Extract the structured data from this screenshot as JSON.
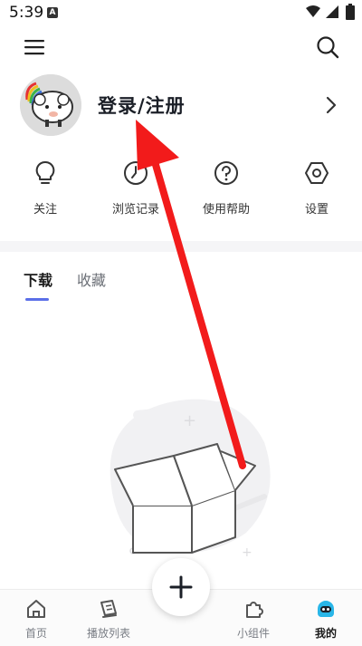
{
  "status_bar": {
    "time": "5:39",
    "app_badge": "A"
  },
  "profile": {
    "login_label": "登录/注册"
  },
  "quick_actions": [
    "关注",
    "浏览记录",
    "使用帮助",
    "设置"
  ],
  "tabs": {
    "downloads": "下载",
    "favorites": "收藏"
  },
  "bottom_nav": {
    "home": "首页",
    "playlist": "播放列表",
    "widgets": "小组件",
    "mine": "我的"
  },
  "colors": {
    "accent": "#5b6fe8",
    "annotation": "#f21b1b",
    "mine_icon": "#29b6e8"
  },
  "icons": {
    "menu": "hamburger-menu-icon",
    "search": "search-icon",
    "chevron": "chevron-right-icon",
    "follow": "lightbulb-icon",
    "history": "history-icon",
    "help": "help-icon",
    "settings": "settings-icon",
    "add": "plus-icon"
  }
}
